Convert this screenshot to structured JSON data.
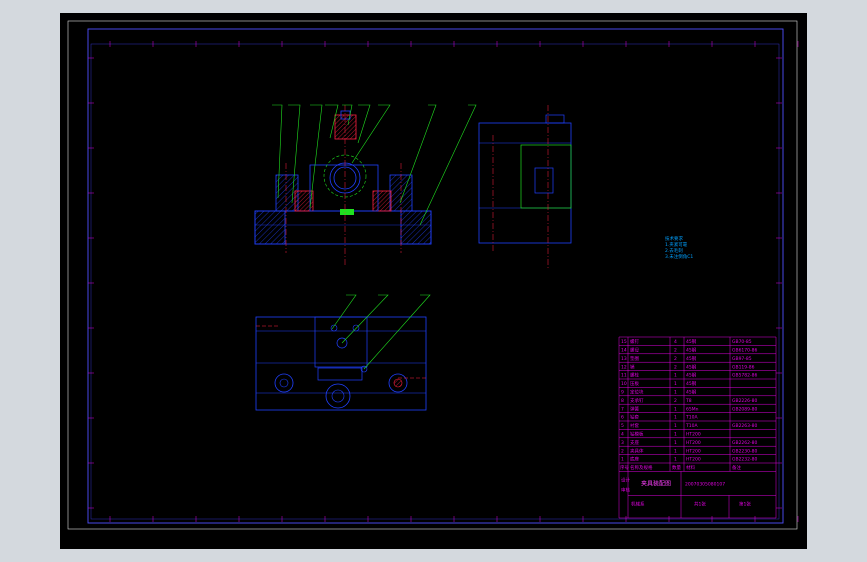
{
  "drawing": {
    "colors": {
      "background": "#000000",
      "frame": "#5050ff",
      "part": "#2040ff",
      "leader": "#20e020",
      "section_red": "#ff2040",
      "title_text": "#e000e0",
      "note_text": "#00a0ff"
    },
    "technical_notes": [
      "技术要求",
      "1.夹紧可靠",
      "2.去毛刺",
      "3.未注倒角C1"
    ],
    "title_block": {
      "rows": [
        {
          "no": "15",
          "name": "螺钉",
          "qty": "4",
          "mat": "45钢",
          "note": "GB70-85"
        },
        {
          "no": "14",
          "name": "螺母",
          "qty": "2",
          "mat": "45钢",
          "note": "GB6170-86"
        },
        {
          "no": "13",
          "name": "垫圈",
          "qty": "2",
          "mat": "45钢",
          "note": "GB97-85"
        },
        {
          "no": "12",
          "name": "销",
          "qty": "2",
          "mat": "45钢",
          "note": "GB119-86"
        },
        {
          "no": "11",
          "name": "螺栓",
          "qty": "1",
          "mat": "45钢",
          "note": "GB5782-86"
        },
        {
          "no": "10",
          "name": "压板",
          "qty": "1",
          "mat": "45钢",
          "note": ""
        },
        {
          "no": "9",
          "name": "定位块",
          "qty": "1",
          "mat": "45钢",
          "note": ""
        },
        {
          "no": "8",
          "name": "支承钉",
          "qty": "2",
          "mat": "T8",
          "note": "GB2226-80"
        },
        {
          "no": "7",
          "name": "弹簧",
          "qty": "1",
          "mat": "65Mn",
          "note": "GB2089-80"
        },
        {
          "no": "6",
          "name": "钻套",
          "qty": "1",
          "mat": "T10A",
          "note": ""
        },
        {
          "no": "5",
          "name": "衬套",
          "qty": "1",
          "mat": "T10A",
          "note": "GB2263-80"
        },
        {
          "no": "4",
          "name": "钻模板",
          "qty": "1",
          "mat": "HT200",
          "note": ""
        },
        {
          "no": "3",
          "name": "支座",
          "qty": "1",
          "mat": "HT200",
          "note": "GB2262-80"
        },
        {
          "no": "2",
          "name": "夹具体",
          "qty": "1",
          "mat": "HT200",
          "note": "GB2230-80"
        },
        {
          "no": "1",
          "name": "底座",
          "qty": "1",
          "mat": "HT200",
          "note": "GB2232-80"
        }
      ],
      "header": {
        "no": "序号",
        "name": "名称及规格",
        "qty": "数量",
        "mat": "材料",
        "note": "备注"
      },
      "title": "夹具装配图",
      "drawing_no": "20070305080107",
      "label_sheet": "共1张",
      "label_page": "第1张",
      "label_school": "机械系",
      "label_design": "设计",
      "label_check": "审核"
    }
  }
}
